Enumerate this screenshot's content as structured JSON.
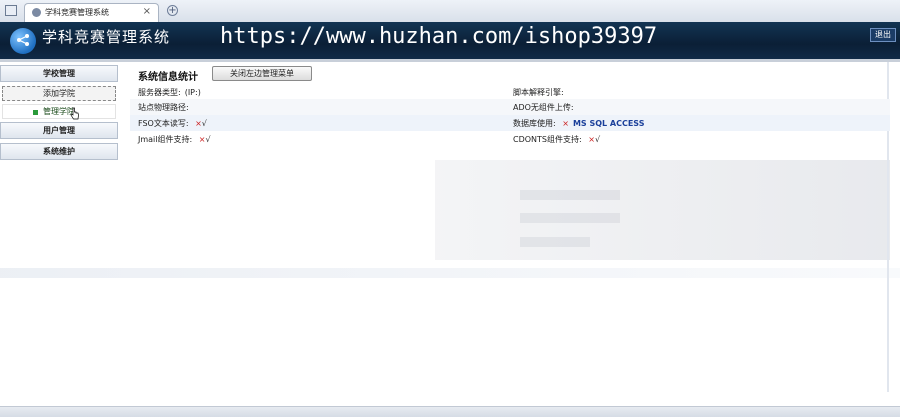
{
  "browser": {
    "tab_title": "学科竞赛管理系统",
    "tab_close": "×",
    "new_tab": "+"
  },
  "header": {
    "app_title": "学科竞赛管理系统",
    "watermark": "https://www.huzhan.com/ishop39397",
    "logout_label": "退出"
  },
  "sidebar": {
    "sections": [
      {
        "label": "学校管理"
      },
      {
        "label": "用户管理"
      },
      {
        "label": "系统维护"
      }
    ],
    "sub_items": [
      {
        "label": "添加学院"
      },
      {
        "label": "管理学院"
      }
    ]
  },
  "main": {
    "title": "系统信息统计",
    "toggle_button": "关闭左边管理菜单",
    "rows": [
      {
        "left_label": "服务器类型:",
        "left_value": "(IP:)",
        "right_label": "脚本解释引擎:",
        "right_value": ""
      },
      {
        "left_label": "站点物理路径:",
        "left_value": "",
        "right_label": "ADO无组件上传:",
        "right_value": ""
      },
      {
        "left_label": "FSO文本读写:",
        "left_cross": "×",
        "left_check": "√",
        "right_label": "数据库使用:",
        "right_cross": "×",
        "right_db": "MS SQL ACCESS"
      },
      {
        "left_label": "Jmail组件支持:",
        "left_cross": "×",
        "left_check": "√",
        "right_label": "CDONTS组件支持:",
        "right_cross": "×",
        "right_check": "√"
      }
    ]
  },
  "colors": {
    "header_bg": "#0b1f36",
    "cross": "#cc2222",
    "db_text": "#1a3f9a",
    "active_bullet": "#2a9a3a"
  }
}
